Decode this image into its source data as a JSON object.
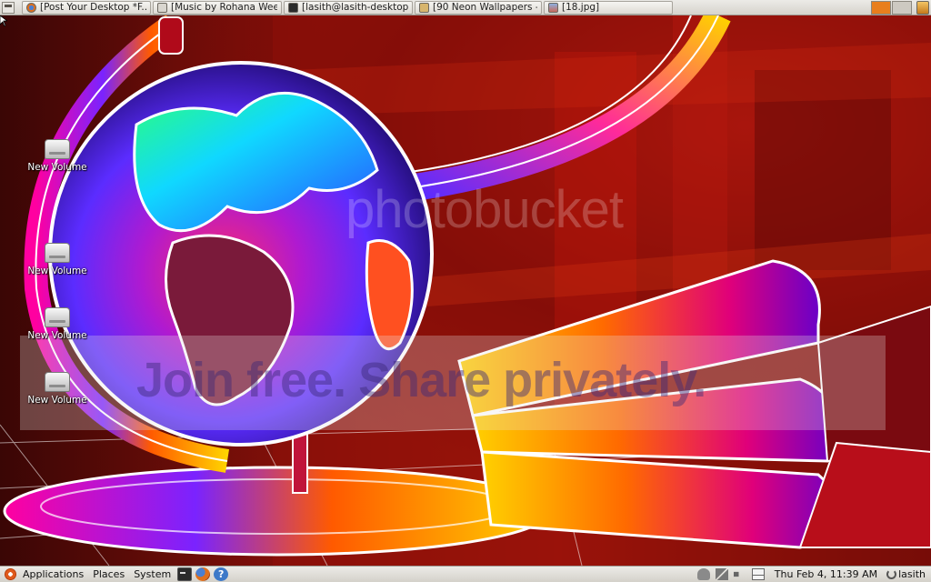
{
  "top_panel": {
    "tasks": [
      {
        "label": "[Post Your Desktop *F...",
        "icon": "firefox-icon"
      },
      {
        "label": "[Music by Rohana Wee...",
        "icon": "music-player-icon"
      },
      {
        "label": "[lasith@lasith-desktop...",
        "icon": "terminal-icon"
      },
      {
        "label": "[90 Neon Wallpapers - ...",
        "icon": "folder-icon"
      },
      {
        "label": "[18.jpg]",
        "icon": "image-viewer-icon"
      }
    ],
    "workspaces": [
      {
        "active": true
      },
      {
        "active": false
      }
    ]
  },
  "desktop": {
    "icons": [
      {
        "label": "New Volume",
        "icon": "drive-icon"
      },
      {
        "label": "New Volume",
        "icon": "drive-icon"
      },
      {
        "label": "New Volume",
        "icon": "drive-icon"
      },
      {
        "label": "New Volume",
        "icon": "drive-icon"
      }
    ],
    "watermark": {
      "logo": "photobucket",
      "tagline": "Join free. Share privately."
    }
  },
  "bottom_panel": {
    "menus": {
      "applications": "Applications",
      "places": "Places",
      "system": "System"
    },
    "launchers": [
      "terminal-icon",
      "firefox-icon",
      "help-icon"
    ],
    "tray": [
      "network-user-icon",
      "network-icon",
      "volume-icon",
      "mail-icon"
    ],
    "clock": "Thu Feb  4, 11:39 AM",
    "user": "lasith"
  },
  "colors": {
    "panel": "#dfdcd6",
    "workspace_active": "#e87e1d",
    "wallpaper_base": "#8c110a"
  }
}
